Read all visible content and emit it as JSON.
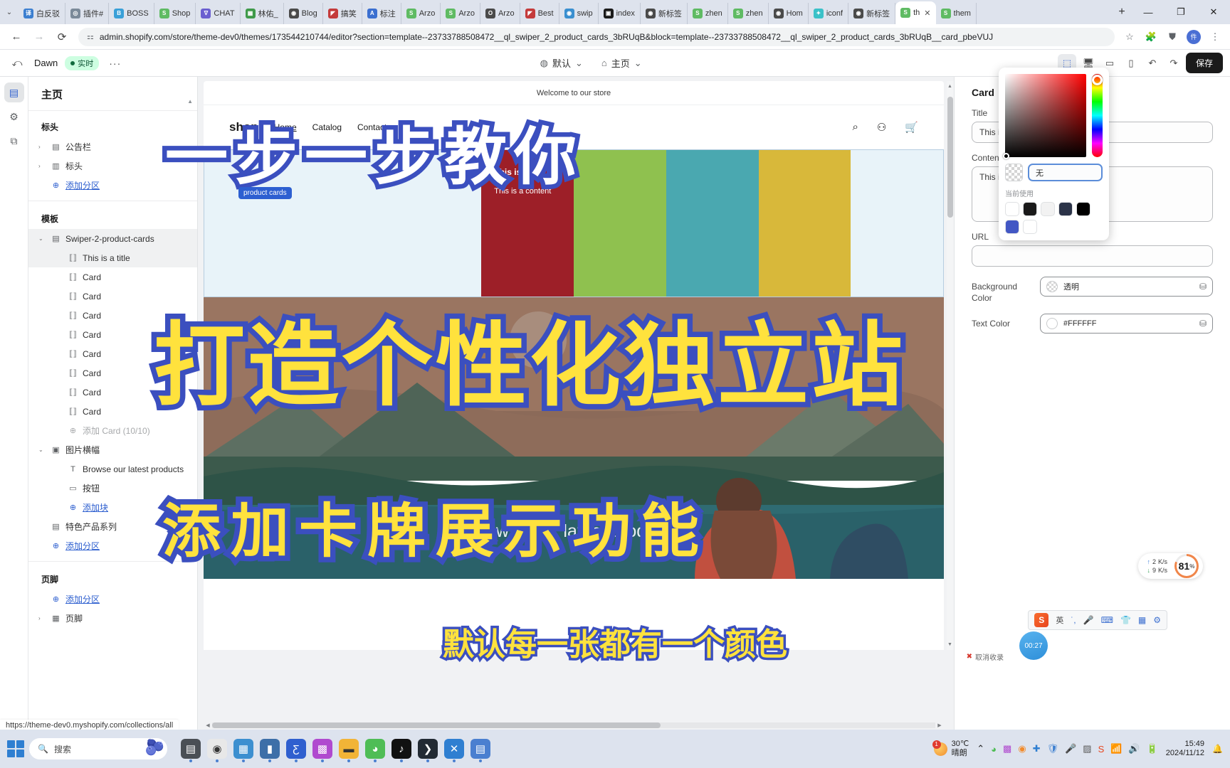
{
  "browser": {
    "tabs": [
      {
        "title": "白反驳",
        "fav": "译",
        "color": "#3c7fd0"
      },
      {
        "title": "插件#",
        "fav": "◎",
        "color": "#7b8a99"
      },
      {
        "title": "BOSS",
        "fav": "B",
        "color": "#3aa0d8"
      },
      {
        "title": "Shop",
        "fav": "S",
        "color": "#5fbb63"
      },
      {
        "title": "CHAT",
        "fav": "∇",
        "color": "#6b5fd0"
      },
      {
        "title": "林佑_",
        "fav": "▦",
        "color": "#3f9a4a"
      },
      {
        "title": "Blog",
        "fav": "◉",
        "color": "#4a4a4a"
      },
      {
        "title": "搞笑",
        "fav": "◤",
        "color": "#c43b3b"
      },
      {
        "title": "标注",
        "fav": "A",
        "color": "#3b6fd0"
      },
      {
        "title": "Arzo",
        "fav": "S",
        "color": "#5fbb63"
      },
      {
        "title": "Arzo",
        "fav": "S",
        "color": "#5fbb63"
      },
      {
        "title": "Arzo",
        "fav": "O",
        "color": "#4a4a4a"
      },
      {
        "title": "Best",
        "fav": "◤",
        "color": "#c43b3b"
      },
      {
        "title": "swip",
        "fav": "◉",
        "color": "#3a8fd0"
      },
      {
        "title": "index",
        "fav": "▣",
        "color": "#1a1a1a"
      },
      {
        "title": "新标签",
        "fav": "◉",
        "color": "#4a4a4a"
      },
      {
        "title": "zhen",
        "fav": "S",
        "color": "#5fbb63"
      },
      {
        "title": "zhen",
        "fav": "S",
        "color": "#5fbb63"
      },
      {
        "title": "Hom",
        "fav": "◉",
        "color": "#4a4a4a"
      },
      {
        "title": "iconf",
        "fav": "✦",
        "color": "#3ac1c8"
      },
      {
        "title": "新标签",
        "fav": "◉",
        "color": "#4a4a4a"
      },
      {
        "title": "th",
        "fav": "S",
        "color": "#5fbb63",
        "active": true
      },
      {
        "title": "them",
        "fav": "S",
        "color": "#5fbb63"
      }
    ],
    "new_tab_label": "+",
    "close_tab_label": "✕",
    "window_minimize": "—",
    "window_maximize": "❐",
    "window_close": "✕",
    "back_label": "←",
    "forward_label": "→",
    "reload_label": "⟳",
    "url": "admin.shopify.com/store/theme-dev0/themes/1735442107‍44/editor?section=template--23733788508472__ql_swiper_2_product_cards_3bRUqB&block=template--23733788508472__ql_swiper_2_product_cards_3bRUqB__card_pbeVUJ",
    "site_icon": "⚏",
    "star_icon": "☆",
    "ext_icon": "⛊",
    "profile_initial": "件正",
    "menu_icon": "⋮"
  },
  "editor": {
    "exit_icon": "⤺",
    "theme_name": "Dawn",
    "badge_label": "实时",
    "more_label": "···",
    "view_chip_label": "默认",
    "page_chip_label": "主页",
    "view_chip_icon": "◍",
    "page_chip_icon": "⌂",
    "chip_caret": "⌄",
    "toolbar_icons": [
      "inspect-icon",
      "desktop-icon",
      "tablet-icon",
      "mobile-icon",
      "undo-icon",
      "redo-icon"
    ],
    "save_label": "保存"
  },
  "rail": {
    "items": [
      {
        "name": "sections-icon",
        "glyph": "▤",
        "active": true
      },
      {
        "name": "settings-icon",
        "glyph": "⚙",
        "active": false
      },
      {
        "name": "apps-icon",
        "glyph": "⧉",
        "active": false
      }
    ]
  },
  "sidebar": {
    "title": "主页",
    "groups": [
      {
        "label": "标头",
        "rows": [
          {
            "caret": "›",
            "icon": "▤",
            "label": "公告栏",
            "kind": "normal"
          },
          {
            "caret": "›",
            "icon": "▥",
            "label": "标头",
            "kind": "normal"
          },
          {
            "caret": "",
            "icon": "⊕",
            "label": "添加分区",
            "kind": "add"
          }
        ]
      },
      {
        "label": "模板",
        "rows": [
          {
            "caret": "⌄",
            "icon": "▤",
            "label": "Swiper-2-product-cards",
            "kind": "selected-parent"
          },
          {
            "caret": "",
            "icon": "⟦⟧",
            "label": "This is a title",
            "kind": "child-selected"
          },
          {
            "caret": "",
            "icon": "⟦⟧",
            "label": "Card",
            "kind": "child"
          },
          {
            "caret": "",
            "icon": "⟦⟧",
            "label": "Card",
            "kind": "child"
          },
          {
            "caret": "",
            "icon": "⟦⟧",
            "label": "Card",
            "kind": "child"
          },
          {
            "caret": "",
            "icon": "⟦⟧",
            "label": "Card",
            "kind": "child"
          },
          {
            "caret": "",
            "icon": "⟦⟧",
            "label": "Card",
            "kind": "child"
          },
          {
            "caret": "",
            "icon": "⟦⟧",
            "label": "Card",
            "kind": "child"
          },
          {
            "caret": "",
            "icon": "⟦⟧",
            "label": "Card",
            "kind": "child"
          },
          {
            "caret": "",
            "icon": "⟦⟧",
            "label": "Card",
            "kind": "child"
          },
          {
            "caret": "",
            "icon": "⊕",
            "label": "添加 Card (10/10)",
            "kind": "disabled"
          },
          {
            "caret": "⌄",
            "icon": "▣",
            "label": "图片横幅",
            "kind": "normal"
          },
          {
            "caret": "",
            "icon": "T",
            "label": "Browse our latest products",
            "kind": "child"
          },
          {
            "caret": "",
            "icon": "▭",
            "label": "按钮",
            "kind": "child"
          },
          {
            "caret": "",
            "icon": "⊕",
            "label": "添加块",
            "kind": "add-child"
          },
          {
            "caret": "",
            "icon": "▤",
            "label": "特色产品系列",
            "kind": "normal-noindent"
          },
          {
            "caret": "",
            "icon": "⊕",
            "label": "添加分区",
            "kind": "add"
          }
        ]
      },
      {
        "label": "页脚",
        "rows": [
          {
            "caret": "",
            "icon": "⊕",
            "label": "添加分区",
            "kind": "add"
          },
          {
            "caret": "›",
            "icon": "▦",
            "label": "页脚",
            "kind": "normal"
          }
        ]
      }
    ]
  },
  "preview": {
    "announcement": "Welcome to our store",
    "logo": "shop",
    "nav": [
      "Home",
      "Catalog",
      "Contact"
    ],
    "nav_active": "Home",
    "actions": [
      "search-icon",
      "account-icon",
      "cart-icon"
    ],
    "tooltip": "product cards",
    "card_title": "This is a title",
    "card_content": "This is a content",
    "hero_cta": "Browse our latest products",
    "card_colors": [
      "#e8f3f9",
      "#e8f3f9",
      "#e8f3f9",
      "#9d1f28",
      "#8fc14f",
      "#4aa8b0",
      "#d8b83a",
      "#e8f3f9"
    ]
  },
  "settings": {
    "panel_title": "Card",
    "fields": [
      {
        "label": "Title",
        "value": "This is a title",
        "type": "input"
      },
      {
        "label": "Content",
        "value": "This is a content",
        "type": "textarea"
      },
      {
        "label": "URL",
        "value": "",
        "type": "input"
      }
    ],
    "background_color": {
      "label": "Background Color",
      "value": "透明",
      "swatch": "checker"
    },
    "text_color": {
      "label": "Text Color",
      "value": "#FFFFFF",
      "swatch": "white"
    },
    "stack_icon": "⛁"
  },
  "color_picker": {
    "value": "无",
    "recent_label": "当前使用",
    "recent_swatches": [
      "#ffffff",
      "#1a1a1a",
      "#f2f2f2",
      "#2b3348",
      "#000000",
      "#4257c4",
      "#ffffff"
    ],
    "hue": "#ff0000"
  },
  "overlay": {
    "line1": "一步一步教你",
    "line2": "打造个性化独立站",
    "line3": "添加卡牌展示功能",
    "subtitle": "默认每一张都有一个颜色",
    "stroke_color": "#3b4fbf",
    "fill_color": "#ffe23d"
  },
  "widgets": {
    "net_up": "2",
    "net_down": "9",
    "net_unit": "K/s",
    "net_up_icon": "↑",
    "net_down_icon": "↓",
    "cpu_value": "81",
    "cpu_unit": "%",
    "ime_logo": "S",
    "ime_mode": "英",
    "ime_icons": [
      "punctuation-icon",
      "mic-icon",
      "keyboard-icon",
      "skin-icon",
      "apps-icon",
      "settings-icon"
    ],
    "timer": "00:27",
    "record_label": "取消收录",
    "record_icon": "✖"
  },
  "status_url": "https://theme-dev0.myshopify.com/collections/all",
  "taskbar": {
    "search_placeholder": "搜索",
    "search_icon": "search-icon",
    "apps": [
      {
        "name": "taskview-icon",
        "glyph": "▤",
        "color": "#4a4f55"
      },
      {
        "name": "chrome-icon",
        "glyph": "◉",
        "color": "#e8e8e8"
      },
      {
        "name": "photos-icon",
        "glyph": "▦",
        "color": "#3c8fd0"
      },
      {
        "name": "store-icon",
        "glyph": "▮",
        "color": "#3d6fa8"
      },
      {
        "name": "powershell-icon",
        "glyph": "Ƹ",
        "color": "#2f5fcf"
      },
      {
        "name": "qr-icon",
        "glyph": "▩",
        "color": "#b04acf"
      },
      {
        "name": "explorer-icon",
        "glyph": "▬",
        "color": "#f2b437"
      },
      {
        "name": "wechat-icon",
        "glyph": "◕",
        "color": "#4fbd56"
      },
      {
        "name": "tiktok-icon",
        "glyph": "♪",
        "color": "#111111"
      },
      {
        "name": "terminal-icon",
        "glyph": "❯",
        "color": "#222a33"
      },
      {
        "name": "vscode-icon",
        "glyph": "✕",
        "color": "#2f7fd1"
      },
      {
        "name": "notepad-icon",
        "glyph": "▤",
        "color": "#4a7fd0"
      }
    ],
    "weather_temp": "30℃",
    "weather_desc": "晴朗",
    "weather_badge": "1",
    "tray_icons": [
      "chevron-up-icon",
      "wechat-icon",
      "app-icon",
      "xbox-icon",
      "bluetooth-icon",
      "defender-icon",
      "mic-icon",
      "net-icon",
      "sogou-icon",
      "wifi-icon",
      "volume-icon",
      "battery-icon"
    ],
    "time": "15:49",
    "date": "2024/11/12",
    "notification_icon": "🔔"
  }
}
